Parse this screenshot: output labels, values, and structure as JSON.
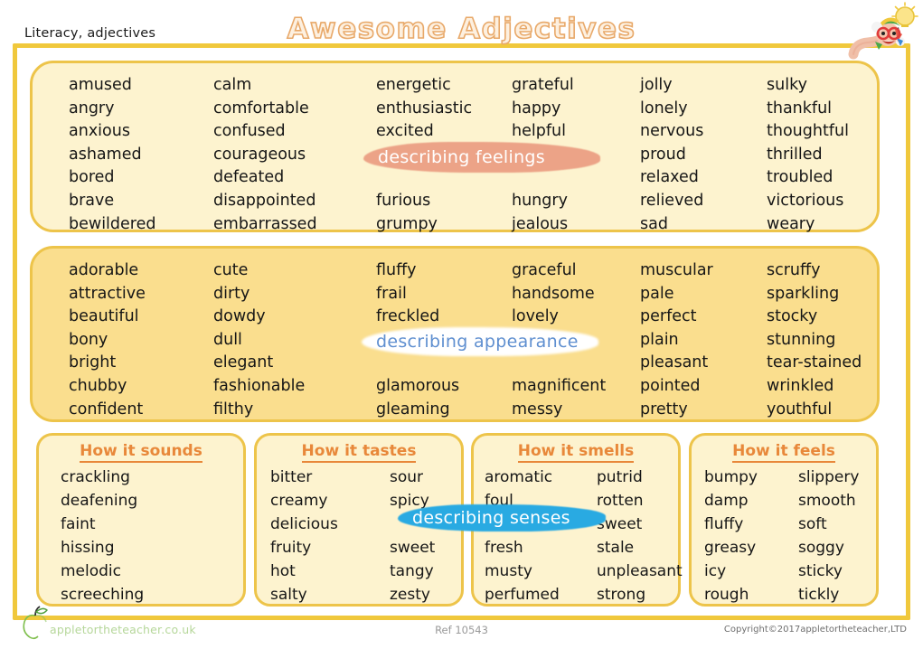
{
  "header": {
    "subject_label": "Literacy, adjectives",
    "title": "Awesome Adjectives"
  },
  "colors": {
    "frame_gold": "#f0c83c",
    "panel_cream": "#fdf3cf",
    "panel_gold": "#fade8e",
    "title_outline": "#e8a96a",
    "banner_feelings": "#eca387",
    "banner_appearance_text": "#5f8fd0",
    "banner_senses": "#29aae2",
    "heading_orange": "#e8883a",
    "brand_green": "#b6d79a"
  },
  "panels": [
    {
      "name": "describing-feelings",
      "banner_label": "describing feelings",
      "columns": [
        [
          "amused",
          "angry",
          "anxious",
          "ashamed",
          "bored",
          "brave",
          "bewildered"
        ],
        [
          "calm",
          "comfortable",
          "confused",
          "courageous",
          "defeated",
          "disappointed",
          "embarrassed"
        ],
        [
          "energetic",
          "enthusiastic",
          "excited",
          "",
          "",
          "furious",
          "grumpy"
        ],
        [
          "grateful",
          "happy",
          "helpful",
          "",
          "",
          "hungry",
          "jealous"
        ],
        [
          "jolly",
          "lonely",
          "nervous",
          "proud",
          "relaxed",
          "relieved",
          "sad"
        ],
        [
          "sulky",
          "thankful",
          "thoughtful",
          "thrilled",
          "troubled",
          "victorious",
          "weary"
        ]
      ]
    },
    {
      "name": "describing-appearance",
      "banner_label": "describing appearance",
      "columns": [
        [
          "adorable",
          "attractive",
          "beautiful",
          "bony",
          "bright",
          "chubby",
          "confident"
        ],
        [
          "cute",
          "dirty",
          "dowdy",
          "dull",
          "elegant",
          "fashionable",
          "filthy"
        ],
        [
          "fluffy",
          "frail",
          "freckled",
          "",
          "",
          "glamorous",
          "gleaming"
        ],
        [
          "graceful",
          "handsome",
          "lovely",
          "",
          "",
          "magnificent",
          "messy"
        ],
        [
          "muscular",
          "pale",
          "perfect",
          "plain",
          "pleasant",
          "pointed",
          "pretty"
        ],
        [
          "scruffy",
          "sparkling",
          "stocky",
          "stunning",
          "tear-stained",
          "wrinkled",
          "youthful"
        ]
      ]
    }
  ],
  "senses": {
    "banner_label": "describing senses",
    "boxes": [
      {
        "title": "How it sounds",
        "col_a": [
          "crackling",
          "deafening",
          "faint",
          "hissing",
          "melodic",
          "screeching"
        ],
        "col_b": []
      },
      {
        "title": "How it tastes",
        "col_a": [
          "bitter",
          "creamy",
          "delicious",
          "fruity",
          "hot",
          "salty"
        ],
        "col_b": [
          "sour",
          "spicy",
          "",
          "sweet",
          "tangy",
          "zesty"
        ]
      },
      {
        "title": "How it smells",
        "col_a": [
          "aromatic",
          "foul",
          "",
          "fresh",
          "musty",
          "perfumed"
        ],
        "col_b": [
          "putrid",
          "rotten",
          "sweet",
          "stale",
          "unpleasant",
          "strong"
        ]
      },
      {
        "title": "How it feels",
        "col_a": [
          "bumpy",
          "damp",
          "fluffy",
          "greasy",
          "icy",
          "rough"
        ],
        "col_b": [
          "slippery",
          "smooth",
          "soft",
          "soggy",
          "sticky",
          "tickly"
        ]
      }
    ]
  },
  "footer": {
    "brand": "appletortheteacher.co.uk",
    "ref": "Ref 10543",
    "copyright": "Copyright©2017appletortheteacher,LTD"
  },
  "icons": {
    "mascot": "worm-with-glasses-icon",
    "idea": "lightbulb-icon",
    "apple": "apple-logo-icon"
  }
}
